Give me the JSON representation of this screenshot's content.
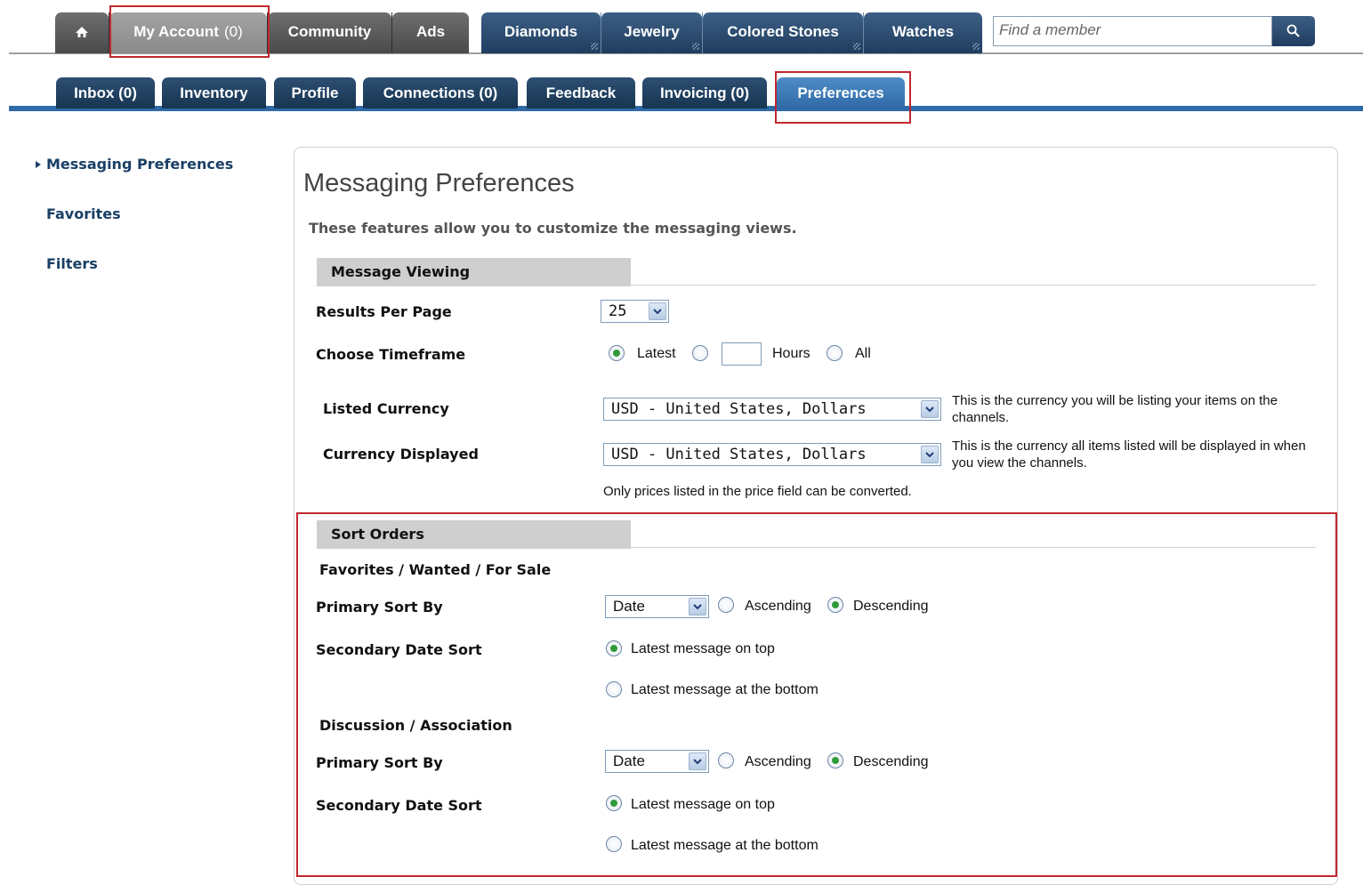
{
  "top_nav": {
    "home_label": "",
    "my_account": {
      "label": "My Account",
      "count": "(0)"
    },
    "community": "Community",
    "ads": "Ads",
    "diamonds": "Diamonds",
    "jewelry": "Jewelry",
    "colored_stones": "Colored Stones",
    "watches": "Watches",
    "search_placeholder": "Find a member"
  },
  "sub_nav": {
    "inbox": "Inbox (0)",
    "inventory": "Inventory",
    "profile": "Profile",
    "connections": "Connections (0)",
    "feedback": "Feedback",
    "invoicing": "Invoicing (0)",
    "preferences": "Preferences"
  },
  "sidebar": {
    "items": [
      "Messaging Preferences",
      "Favorites",
      "Filters"
    ]
  },
  "main": {
    "title": "Messaging Preferences",
    "intro": "These features allow you to customize the messaging views.",
    "message_viewing": {
      "heading": "Message Viewing",
      "results_per_page_label": "Results Per Page",
      "results_per_page_value": "25",
      "timeframe_label": "Choose Timeframe",
      "timeframe_latest": "Latest",
      "timeframe_hours": "Hours",
      "timeframe_all": "All",
      "listed_currency_label": "Listed Currency",
      "listed_currency_value": "USD - United States, Dollars",
      "listed_currency_note": "This is the currency you will be listing your items on the channels.",
      "displayed_currency_label": "Currency Displayed",
      "displayed_currency_value": "USD - United States, Dollars",
      "displayed_currency_note": "This is the currency all items listed will be displayed in when you view the channels.",
      "conversion_note": "Only prices listed in the price field can be converted."
    },
    "sort_orders": {
      "heading": "Sort Orders",
      "groups": [
        {
          "title": "Favorites / Wanted / For Sale",
          "primary_label": "Primary Sort By",
          "primary_value": "Date",
          "ascending": "Ascending",
          "descending": "Descending",
          "secondary_label": "Secondary Date Sort",
          "top_option": "Latest message on top",
          "bottom_option": "Latest message at the bottom"
        },
        {
          "title": "Discussion / Association",
          "primary_label": "Primary Sort By",
          "primary_value": "Date",
          "ascending": "Ascending",
          "descending": "Descending",
          "secondary_label": "Secondary Date Sort",
          "top_option": "Latest message on top",
          "bottom_option": "Latest message at the bottom"
        }
      ]
    }
  }
}
